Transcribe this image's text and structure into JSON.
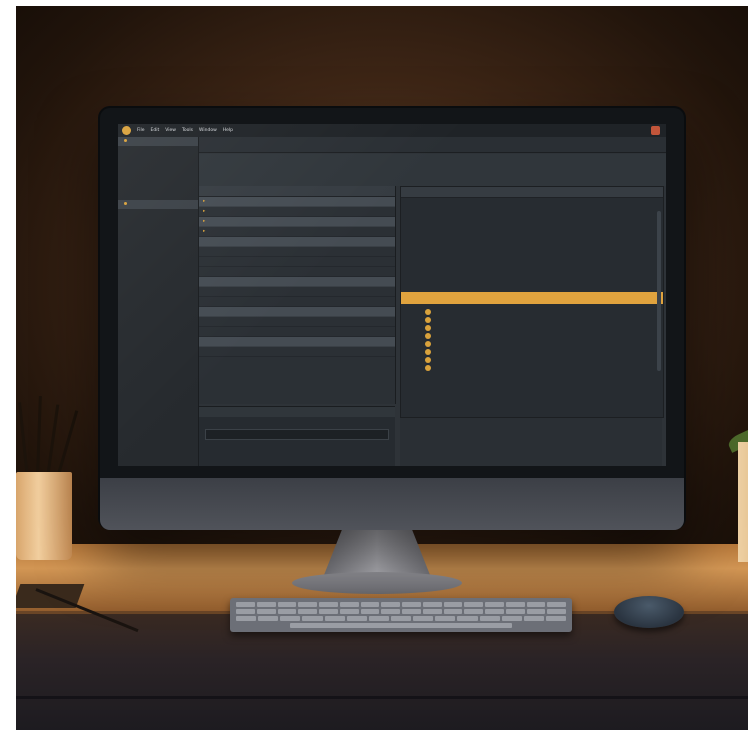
{
  "window": {
    "menu": [
      "File",
      "Edit",
      "View",
      "Tools",
      "Window",
      "Help"
    ]
  },
  "colors": {
    "accent": "#e0a33e",
    "editor_bg": "#2e3338",
    "sidebar_bg": "#262a2e",
    "desk_wood": "#d29654"
  },
  "icons": [
    "app-logo-icon",
    "folder-icon",
    "coin-icon",
    "chevron-right-icon",
    "close-icon"
  ]
}
